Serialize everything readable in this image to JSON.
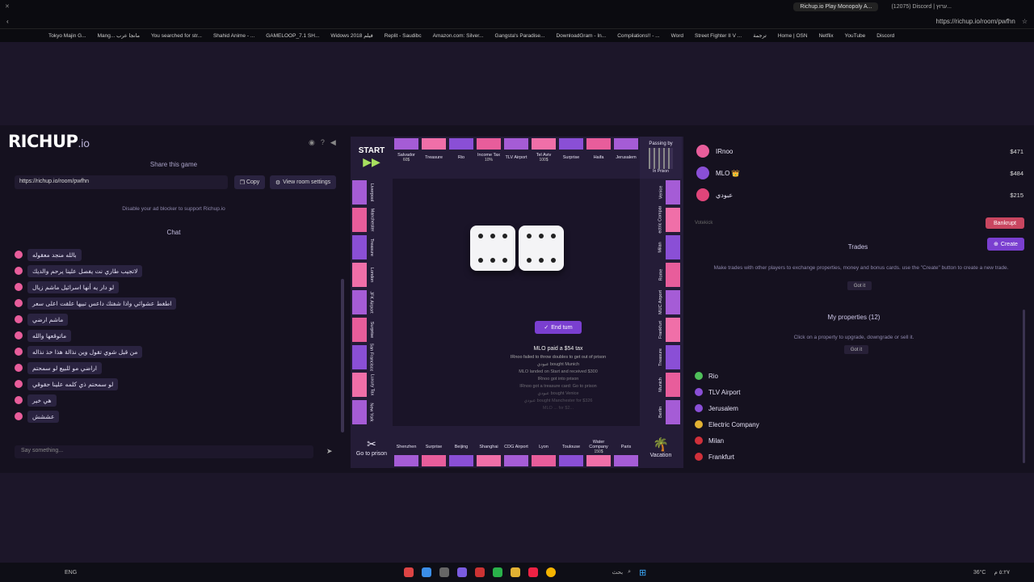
{
  "browser": {
    "tabs": [
      "Richup.io Play Monopoly A...",
      "(12075) Discord | ערוץ..."
    ],
    "url": "https://richup.io/room/pwfhn",
    "bookmarks": [
      "Tokyo Majin G...",
      "Mang... مانجا عرب",
      "You searched for str...",
      "Shahid Anime - ...",
      "GAMELOOP_7.1 SH...",
      "Widows 2018 فيلم",
      "Replit - Saudibc",
      "Amazon.com: Silver...",
      "Gangsta's Paradise...",
      "DownloadGram - In...",
      "Compilations!! - ...",
      "Word",
      "Street Fighter II V ...",
      "ترجمة",
      "Home | OSN",
      "Netflix",
      "YouTube",
      "Discord"
    ]
  },
  "left": {
    "logo_main": "RICHUP",
    "logo_suffix": ".io",
    "share_title": "Share this game",
    "share_url": "https://richup.io/room/pwfhn",
    "copy_label": "Copy",
    "settings_label": "View room settings",
    "adblock_text": "Disable your ad blocker to support Richup.io",
    "chat_title": "Chat",
    "chat_placeholder": "Say something...",
    "messages": [
      "بالله منجد معقوله",
      "لاتجيب طاري نت يفصل علينا يرحم والديك",
      "لو دار يه أنها اسرائيل ماشم زيال",
      "اطغط عشوائي واذا شفتك داعس تبيها علقت اعلى سعر",
      "ماشم ارضي",
      "ماتوقعها والله",
      "من قبل شوي تقول وين نذالة هذا خذ نذاله",
      "اراضي مو للبيع لو سمحتم",
      "لو سمحتم ذي كلمه علينا حقوقي",
      "هي خير",
      "عششش"
    ]
  },
  "board": {
    "start_label": "START",
    "go_to_prison": "Go to prison",
    "vacation": "Vacation",
    "passing_by": "Passing by",
    "in_prison": "In Prison",
    "top": [
      "Salvador",
      "Treasure",
      "Rio",
      "Income Tax",
      "TLV Airport",
      "Tel Aviv",
      "Surprise",
      "Haifa",
      "Jerusalem"
    ],
    "top_prices": [
      "60$",
      "",
      "",
      "10%",
      "",
      "100$",
      "",
      "",
      ""
    ],
    "bottom": [
      "Paris",
      "Water Company",
      "Toulouse",
      "Lyon",
      "CDG Airport",
      "Shanghai",
      "Beijing",
      "Surprise",
      "Shenzhen"
    ],
    "bottom_prices": [
      "",
      "150$",
      "",
      "",
      "",
      "",
      "",
      "",
      ""
    ],
    "left": [
      "New York",
      "Luxury Tax",
      "San Francisco",
      "Surprise",
      "JFK Airport",
      "London",
      "Treasure",
      "Manchester",
      "Liverpool"
    ],
    "right": [
      "Venice",
      "Electric Company",
      "Milan",
      "Rome",
      "MUC Airport",
      "Frankfurt",
      "Treasure",
      "Munich",
      "Berlin"
    ],
    "end_turn_label": "End turn",
    "log_first": "MLO paid a $54 tax",
    "log": [
      "IRnoo failed to throw doubles to get out of prison",
      "عبودي bought Munich",
      "MLO landed on Start and received $300",
      "IRnoo got into prison",
      "IRnoo got a treasure card: Go to prison",
      "عبودي bought Venice",
      "عبودي bought Manchester for $326",
      "MLO ... for $2..."
    ]
  },
  "right": {
    "players": [
      {
        "name": "IRnoo",
        "money": "$471",
        "color": "#e85d9b"
      },
      {
        "name": "MLO 👑",
        "money": "$484",
        "color": "#8a4fd6"
      },
      {
        "name": "عبودي",
        "money": "$215",
        "color": "#e0457a"
      }
    ],
    "votekick_label": "Votekick",
    "bankrupt_label": "Bankrupt",
    "trades_title": "Trades",
    "create_label": "Create",
    "trades_info": "Make trades with other players to exchange properties, money and bonus cards. use the \"Create\" button to create a new trade.",
    "got_it_label": "Got it",
    "props_title": "My properties (12)",
    "props_info": "Click on a property to upgrade, downgrade or sell it.",
    "properties": [
      "Rio",
      "TLV Airport",
      "Jerusalem",
      "Electric Company",
      "Milan",
      "Frankfurt"
    ]
  },
  "taskbar": {
    "lang": "ENG",
    "search_label": "بحث",
    "temp": "36°C",
    "time": "٥:٢٧ م"
  }
}
